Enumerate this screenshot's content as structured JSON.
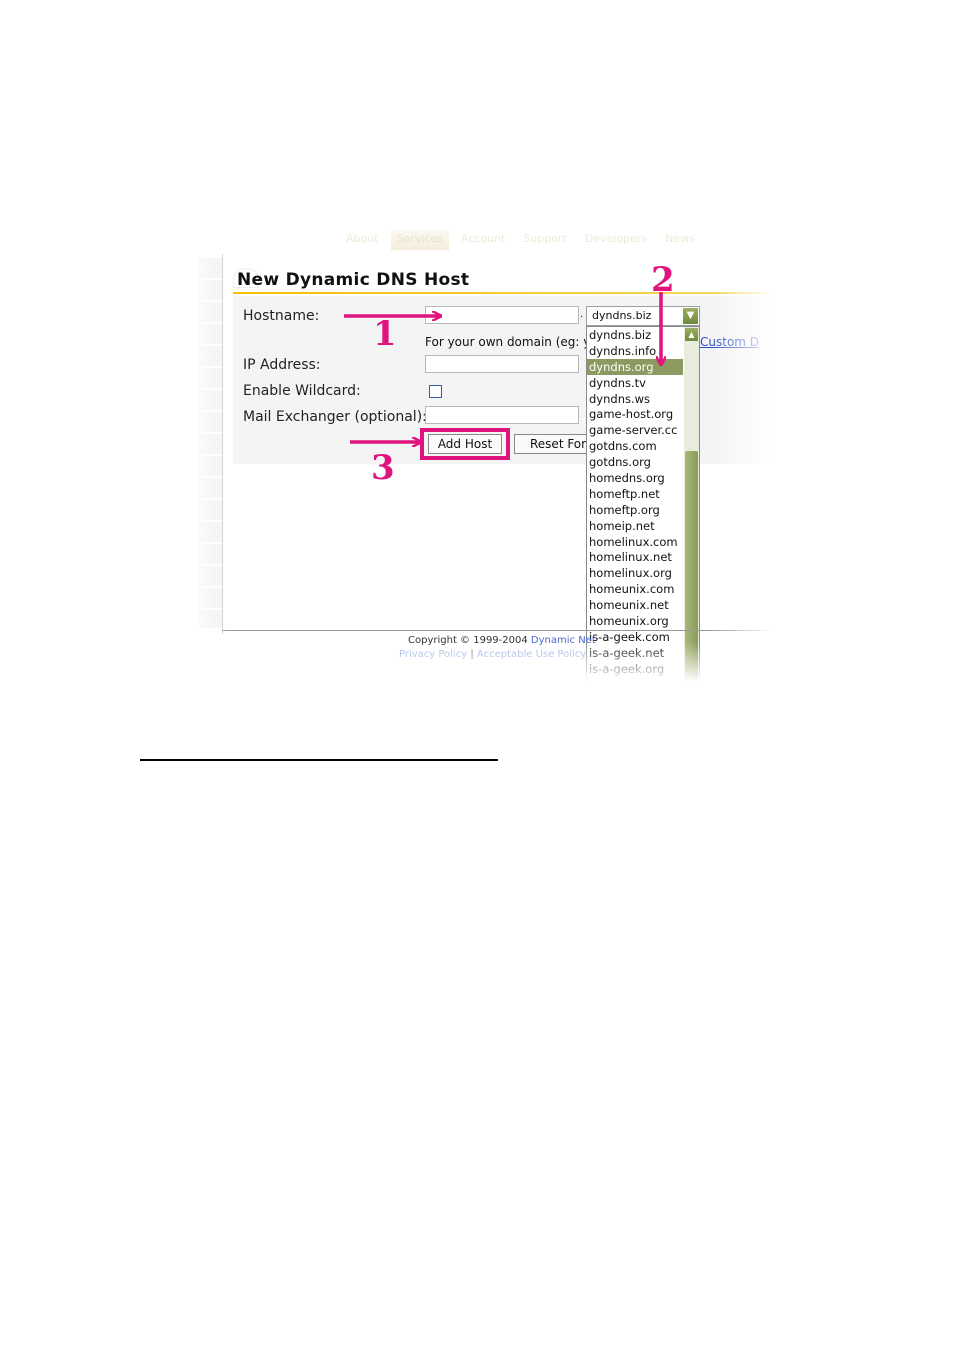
{
  "nav": {
    "tabs": [
      "About",
      "Services",
      "Account",
      "Support",
      "Developers",
      "News"
    ]
  },
  "page": {
    "title": "New Dynamic DNS Host"
  },
  "form": {
    "hostname_label": "Hostname:",
    "hostname_value": "",
    "dot": ".",
    "own_domain_hint": "For your own domain (eg: yo",
    "custom_link": "Custom D",
    "ip_label": "IP Address:",
    "ip_value": "",
    "wildcard_label": "Enable Wildcard:",
    "mx_label": "Mail Exchanger (optional):",
    "mx_value": "",
    "add_host_label": "Add Host",
    "reset_label": "Reset For"
  },
  "domain_select": {
    "selected": "dyndns.biz",
    "highlighted": "dyndns.org",
    "options": [
      "dyndns.biz",
      "dyndns.info",
      "dyndns.org",
      "dyndns.tv",
      "dyndns.ws",
      "game-host.org",
      "game-server.cc",
      "gotdns.com",
      "gotdns.org",
      "homedns.org",
      "homeftp.net",
      "homeftp.org",
      "homeip.net",
      "homelinux.com",
      "homelinux.net",
      "homelinux.org",
      "homeunix.com",
      "homeunix.net",
      "homeunix.org",
      "is-a-geek.com",
      "is-a-geek.net",
      "is-a-geek.org"
    ]
  },
  "footer": {
    "copyright": "Copyright © 1999-2004",
    "company": "Dynamic Net",
    "privacy": "Privacy Policy",
    "separator": "|",
    "aup": "Acceptable Use Policy"
  },
  "annotations": {
    "step1": "1",
    "step2": "2",
    "step3": "3",
    "color": "#e0147e"
  }
}
